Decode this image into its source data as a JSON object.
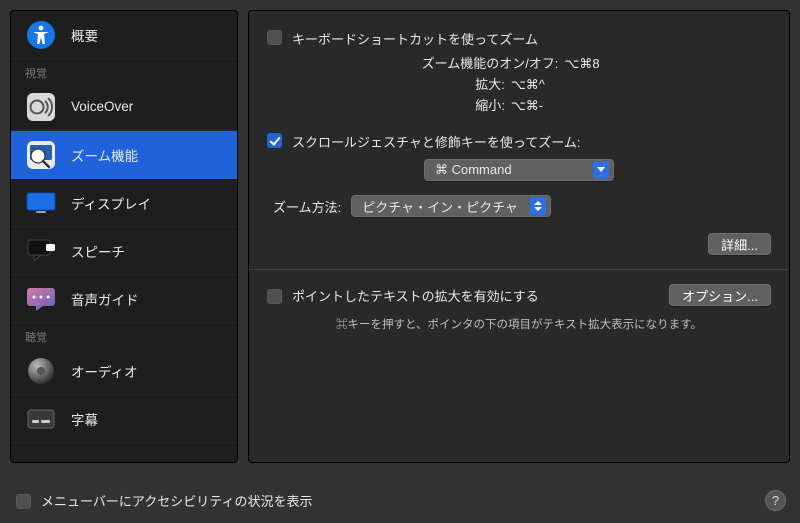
{
  "sidebar": {
    "items": [
      {
        "label": "概要",
        "icon": "accessibility"
      },
      {
        "section": "視覚"
      },
      {
        "label": "VoiceOver",
        "icon": "voiceover"
      },
      {
        "label": "ズーム機能",
        "icon": "zoom",
        "selected": true
      },
      {
        "label": "ディスプレイ",
        "icon": "display"
      },
      {
        "label": "スピーチ",
        "icon": "speech"
      },
      {
        "label": "音声ガイド",
        "icon": "descriptions"
      },
      {
        "section": "聴覚"
      },
      {
        "label": "オーディオ",
        "icon": "audio"
      },
      {
        "label": "字幕",
        "icon": "captions"
      }
    ]
  },
  "detail": {
    "useShortcuts": {
      "checked": false,
      "label": "キーボードショートカットを使ってズーム"
    },
    "shortcuts": {
      "toggle_k": "ズーム機能のオン/オフ:",
      "toggle_v": "⌥⌘8",
      "in_k": "拡大:",
      "in_v": "⌥⌘^",
      "out_k": "縮小:",
      "out_v": "⌥⌘-"
    },
    "useScroll": {
      "checked": true,
      "label": "スクロールジェスチャと修飾キーを使ってズーム:"
    },
    "modifierSelect": {
      "value": "⌘ Command"
    },
    "zoomMethod": {
      "label": "ズーム方法:",
      "value": "ピクチャ・イン・ピクチャ"
    },
    "advancedBtn": "詳細...",
    "hoverText": {
      "checked": false,
      "label": "ポイントしたテキストの拡大を有効にする"
    },
    "optionsBtn": "オプション...",
    "hoverHint": "⌘キーを押すと、ポインタの下の項目がテキスト拡大表示になります。"
  },
  "footer": {
    "menubarCheckbox": {
      "checked": false,
      "label": "メニューバーにアクセシビリティの状況を表示"
    }
  }
}
